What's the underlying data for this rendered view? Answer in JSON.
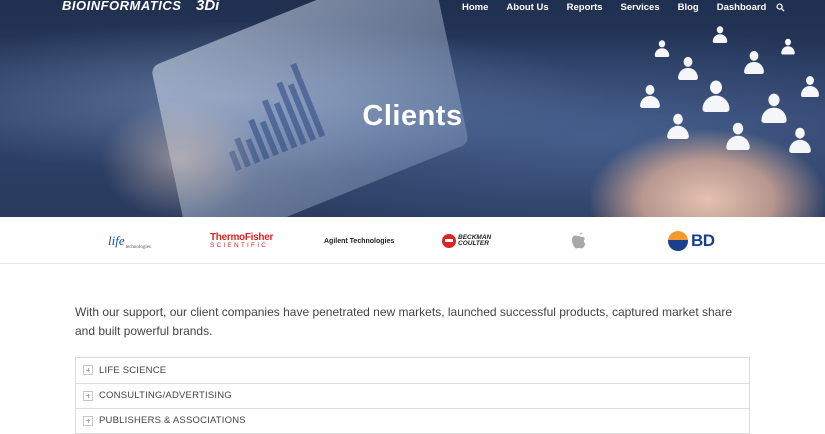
{
  "brand": {
    "logo_text": "BIOINFORMATICS",
    "partner_logo_text": "3Di"
  },
  "nav": {
    "items": [
      "Home",
      "About Us",
      "Reports",
      "Services",
      "Blog",
      "Dashboard"
    ],
    "search_icon": "search-icon"
  },
  "hero": {
    "title": "Clients"
  },
  "clients": {
    "life_tech_main": "life",
    "life_tech_sub": "technologies",
    "thermo_line1": "ThermoFisher",
    "thermo_line2": "SCIENTIFIC",
    "agilent": "Agilent Technologies",
    "beckman_line1": "BECKMAN",
    "beckman_line2": "COULTER",
    "apple_icon": "apple-icon",
    "bd": "BD"
  },
  "intro": {
    "text": "With our support, our client companies have penetrated new markets, launched successful products, captured market share and built powerful brands."
  },
  "accordion": {
    "items": [
      "LIFE SCIENCE",
      "CONSULTING/ADVERTISING",
      "PUBLISHERS & ASSOCIATIONS"
    ]
  },
  "colors": {
    "hero_bg": "#2d4068",
    "thermo_red": "#dd2222",
    "bd_blue": "#1a3f8f",
    "bd_orange": "#f29a2e"
  }
}
